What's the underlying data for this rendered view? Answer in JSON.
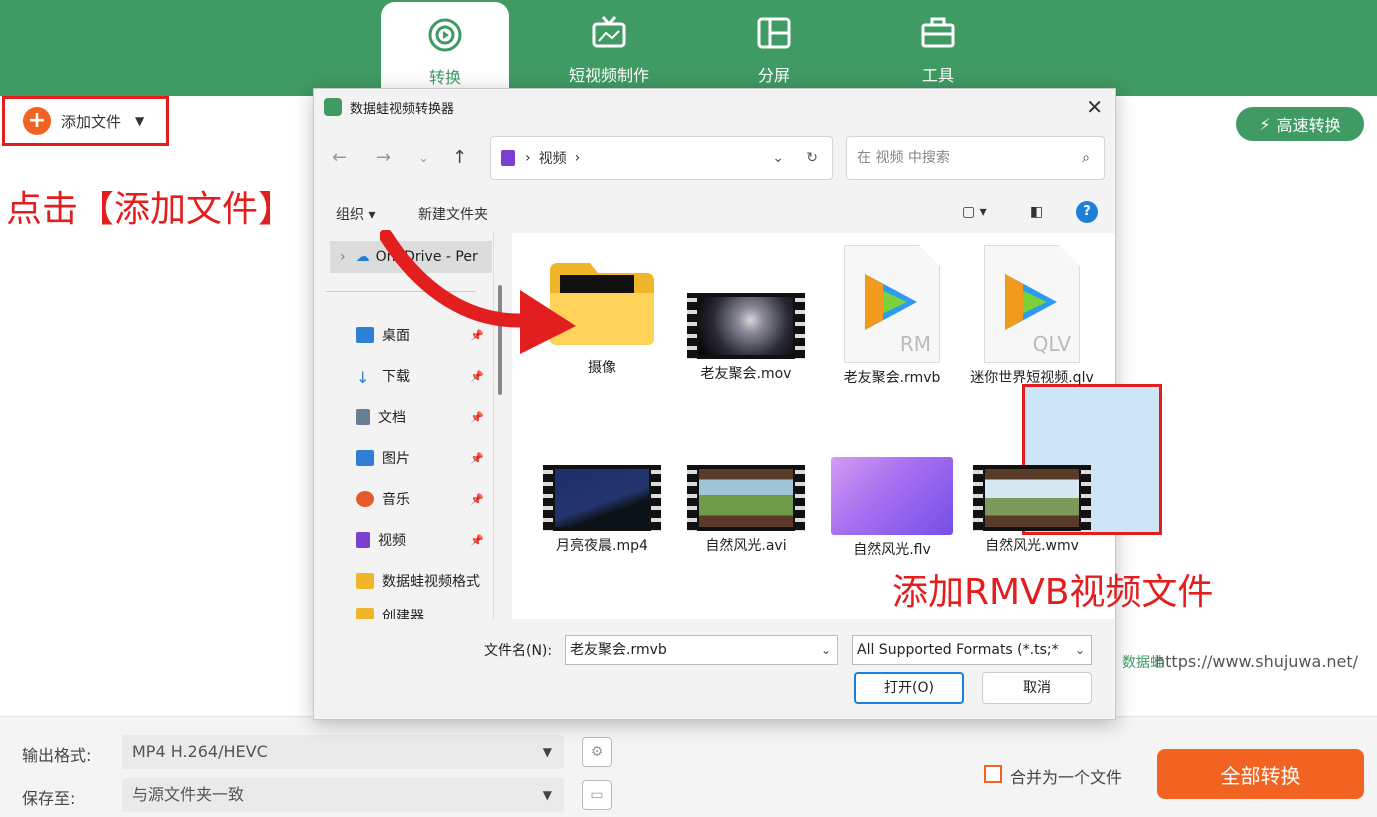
{
  "app": {
    "tabs": [
      {
        "label": "转换",
        "icon": "convert-icon",
        "active": true
      },
      {
        "label": "短视频制作",
        "icon": "tv-icon",
        "active": false
      },
      {
        "label": "分屏",
        "icon": "split-screen-icon",
        "active": false
      },
      {
        "label": "工具",
        "icon": "toolbox-icon",
        "active": false
      }
    ],
    "add_file_label": "添加文件",
    "speed_label": "高速转换",
    "url": "https://www.shujuwa.net/",
    "url_logo": "数据蛙"
  },
  "annotations": {
    "click_add": "点击【添加文件】",
    "add_rmvb": "添加RMVB视频文件"
  },
  "bottom": {
    "output_label": "输出格式:",
    "output_value": "MP4 H.264/HEVC",
    "save_label": "保存至:",
    "save_value": "与源文件夹一致",
    "merge_label": "合并为一个文件",
    "convert_all_label": "全部转换"
  },
  "dialog": {
    "title": "数据蛙视频转换器",
    "address": "视频",
    "search_placeholder": "在 视频 中搜索",
    "organize_label": "组织",
    "new_folder_label": "新建文件夹",
    "nav": {
      "onedrive": "OneDrive - Per",
      "items": [
        {
          "label": "桌面",
          "icon": "desktop-icon",
          "color": "#2f7fd6"
        },
        {
          "label": "下载",
          "icon": "download-icon",
          "color": "#2f7fd6"
        },
        {
          "label": "文档",
          "icon": "document-icon",
          "color": "#6a7f96"
        },
        {
          "label": "图片",
          "icon": "pictures-icon",
          "color": "#2f7fd6"
        },
        {
          "label": "音乐",
          "icon": "music-icon",
          "color": "#e45a2a"
        },
        {
          "label": "视频",
          "icon": "videos-icon",
          "color": "#7d3fd0"
        },
        {
          "label": "数据蛙视频格式",
          "icon": "folder-icon",
          "color": "#f1b52c"
        },
        {
          "label": "创建器",
          "icon": "folder-icon",
          "color": "#f1b52c"
        }
      ]
    },
    "files": [
      {
        "name": "摄像",
        "kind": "folder"
      },
      {
        "name": "老友聚会.mov",
        "kind": "video"
      },
      {
        "name": "老友聚会.rmvb",
        "kind": "doc",
        "ext": "RM",
        "selected": true
      },
      {
        "name": "迷你世界短视频.qlv",
        "kind": "doc",
        "ext": "QLV"
      },
      {
        "name": "月亮夜晨.mp4",
        "kind": "video"
      },
      {
        "name": "自然风光.avi",
        "kind": "video"
      },
      {
        "name": "自然风光.flv",
        "kind": "image"
      },
      {
        "name": "自然风光.wmv",
        "kind": "video"
      }
    ],
    "filename_label": "文件名(N):",
    "filename_value": "老友聚会.rmvb",
    "filetype_value": "All Supported Formats (*.ts;*",
    "open_label": "打开(O)",
    "cancel_label": "取消"
  }
}
